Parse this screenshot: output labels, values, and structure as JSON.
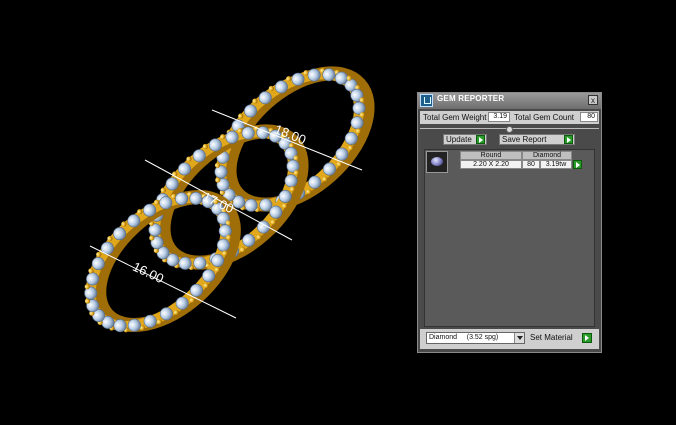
{
  "viewport": {
    "dimensions": [
      "18.00",
      "17.00",
      "16.00"
    ],
    "colors": {
      "gold": "#e2a81c",
      "stone": "#c9dcf2",
      "background": "#000000"
    }
  },
  "panel": {
    "title": "GEM REPORTER",
    "close_glyph": "x",
    "total_weight_label": "Total Gem Weight",
    "total_weight_value": "3.19",
    "total_count_label": "Total Gem Count",
    "total_count_value": "80",
    "update_label": "Update",
    "save_report_label": "Save Report",
    "columns": {
      "shape": "Round",
      "material": "Diamond"
    },
    "row": {
      "size": "2.20 X 2.20",
      "count": "80",
      "weight": "3.19tw"
    },
    "material_selected": "Diamond     (3.52 spg)",
    "set_material_label": "Set Material",
    "colors": {
      "panel_bg": "#4a4a4a",
      "accent_green": "#2a9a2a"
    }
  }
}
